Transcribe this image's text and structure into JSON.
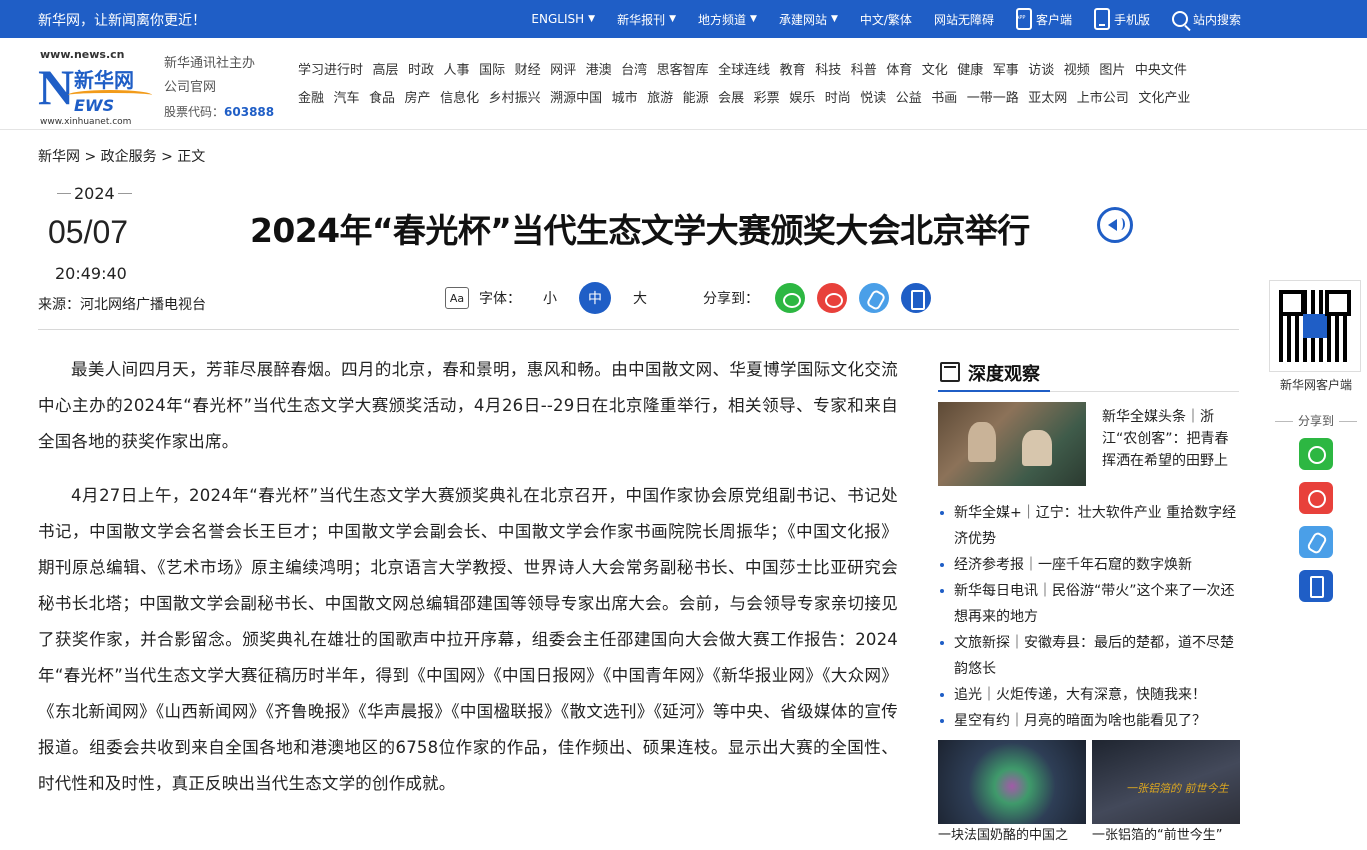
{
  "topbar": {
    "slogan": "新华网，让新闻离你更近！",
    "nav": [
      {
        "label": "ENGLISH",
        "chevron": true
      },
      {
        "label": "新华报刊",
        "chevron": true
      },
      {
        "label": "地方频道",
        "chevron": true
      },
      {
        "label": "承建网站",
        "chevron": true
      },
      {
        "label": "中文/繁体",
        "chevron": false
      },
      {
        "label": "网站无障碍",
        "chevron": false
      }
    ],
    "client_label": "客户端",
    "mobile_label": "手机版",
    "search_label": "站内搜索"
  },
  "header": {
    "logo": {
      "url_top": "www.news.cn",
      "name": "新华网",
      "n": "N",
      "ews": "EWS",
      "url_bottom": "www.xinhuanet.com"
    },
    "org_line1": "新华通讯社主办",
    "org_line2": "公司官网",
    "stock_label": "股票代码：",
    "stock_code": "603888",
    "channels_row1": [
      "学习进行时",
      "高层",
      "时政",
      "人事",
      "国际",
      "财经",
      "网评",
      "港澳",
      "台湾",
      "思客智库",
      "全球连线",
      "教育",
      "科技",
      "科普",
      "体育",
      "文化",
      "健康",
      "军事",
      "访谈",
      "视频",
      "图片",
      "中央文件"
    ],
    "channels_row2": [
      "金融",
      "汽车",
      "食品",
      "房产",
      "信息化",
      "乡村振兴",
      "溯源中国",
      "城市",
      "旅游",
      "能源",
      "会展",
      "彩票",
      "娱乐",
      "时尚",
      "悦读",
      "公益",
      "书画",
      "一带一路",
      "亚太网",
      "上市公司",
      "文化产业"
    ]
  },
  "breadcrumb": "新华网 > 政企服务 > 正文",
  "article": {
    "year": "2024",
    "month_day": "05/07",
    "time": "20:49:40",
    "source": "来源：河北网络广播电视台",
    "title": "2024年“春光杯”当代生态文学大赛颁奖大会北京举行",
    "font_label": "字体：",
    "font_small": "小",
    "font_medium": "中",
    "font_large": "大",
    "font_icon_text": "Aa",
    "share_label": "分享到：",
    "paragraphs": [
      "最美人间四月天，芳菲尽展醉春烟。四月的北京，春和景明，惠风和畅。由中国散文网、华夏博学国际文化交流中心主办的2024年“春光杯”当代生态文学大赛颁奖活动，4月26日--29日在北京隆重举行，相关领导、专家和来自全国各地的获奖作家出席。",
      "4月27日上午，2024年“春光杯”当代生态文学大赛颁奖典礼在北京召开，中国作家协会原党组副书记、书记处书记，中国散文学会名誉会长王巨才；中国散文学会副会长、中国散文学会作家书画院院长周振华；《中国文化报》期刊原总编辑、《艺术市场》原主编续鸿明；北京语言大学教授、世界诗人大会常务副秘书长、中国莎士比亚研究会秘书长北塔；中国散文学会副秘书长、中国散文网总编辑邵建国等领导专家出席大会。会前，与会领导专家亲切接见了获奖作家，并合影留念。颁奖典礼在雄壮的国歌声中拉开序幕，组委会主任邵建国向大会做大赛工作报告：2024年“春光杯”当代生态文学大赛征稿历时半年，得到《中国网》《中国日报网》《中国青年网》《新华报业网》《大众网》《东北新闻网》《山西新闻网》《齐鲁晚报》《华声晨报》《中国楹联报》《散文选刊》《延河》等中央、省级媒体的宣传报道。组委会共收到来自全国各地和港澳地区的6758位作家的作品，佳作频出、硕果连枝。显示出大赛的全国性、时代性和及时性，真正反映出当代生态文学的创作成就。"
    ]
  },
  "sidebar": {
    "heading": "深度观察",
    "featured_text": "新华全媒头条｜浙江“农创客”：把青春挥洒在希望的田野上",
    "list": [
      "新华全媒+｜辽宁：壮大软件产业 重拾数字经济优势",
      "经济参考报｜一座千年石窟的数字焕新",
      "新华每日电讯｜民俗游“带火”这个来了一次还想再来的地方",
      "文旅新探｜安徽寿县：最后的楚都，道不尽楚韵悠长",
      "追光｜火炬传递，大有深意，快随我来！",
      "星空有约｜月亮的暗面为啥也能看见了？"
    ],
    "thumb1_caption": "一块法国奶酪的中国之",
    "thumb2_caption": "一张铝箔的“前世今生”",
    "thumb2_overlay": "一张铝箔的 前世今生"
  },
  "side_panel": {
    "qr_caption": "新华网客户端",
    "share_label": "分享到"
  },
  "colors": {
    "brand_blue": "#1f5ec6",
    "wechat_green": "#2db742",
    "weibo_red": "#e8413b",
    "link_blue": "#4a9fe8"
  }
}
